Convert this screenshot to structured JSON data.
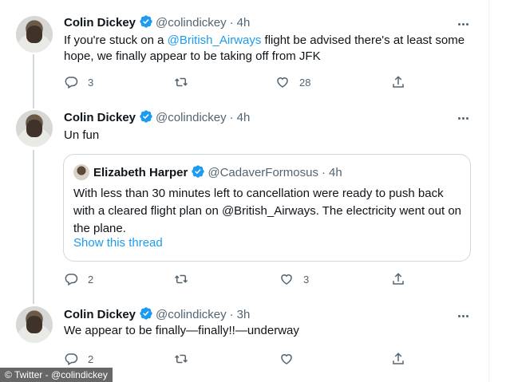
{
  "tweets": [
    {
      "name": "Colin Dickey",
      "handle": "@colindickey",
      "separator": "·",
      "time": "4h",
      "text_before": "If you're stuck on a ",
      "mention": "@British_Airways",
      "text_after": " flight be advised there's at least some hope, we finally appear to be taking off from JFK",
      "reply_count": "3",
      "retweet_count": "",
      "like_count": "28"
    },
    {
      "name": "Colin Dickey",
      "handle": "@colindickey",
      "separator": "·",
      "time": "4h",
      "text": "Un fun",
      "quote": {
        "name": "Elizabeth Harper",
        "handle": "@CadaverFormosus",
        "separator": "·",
        "time": "4h",
        "text": "With less than 30 minutes left to cancellation were ready to push back with a cleared flight plan on @British_Airways. The electricity went out on the plane.",
        "show_thread": "Show this thread"
      },
      "reply_count": "2",
      "retweet_count": "",
      "like_count": "3"
    },
    {
      "name": "Colin Dickey",
      "handle": "@colindickey",
      "separator": "·",
      "time": "3h",
      "text": "We appear to be finally—finally!!—underway",
      "reply_count": "2",
      "retweet_count": "",
      "like_count": ""
    }
  ],
  "watermark": "© Twitter - @colindickey",
  "colors": {
    "accent": "#1d9bf0",
    "secondary_text": "#536471",
    "primary_text": "#0f1419",
    "border": "#cfd9de"
  },
  "icons": [
    "verified-badge-icon",
    "more-options-icon",
    "reply-icon",
    "retweet-icon",
    "like-icon",
    "share-icon"
  ]
}
